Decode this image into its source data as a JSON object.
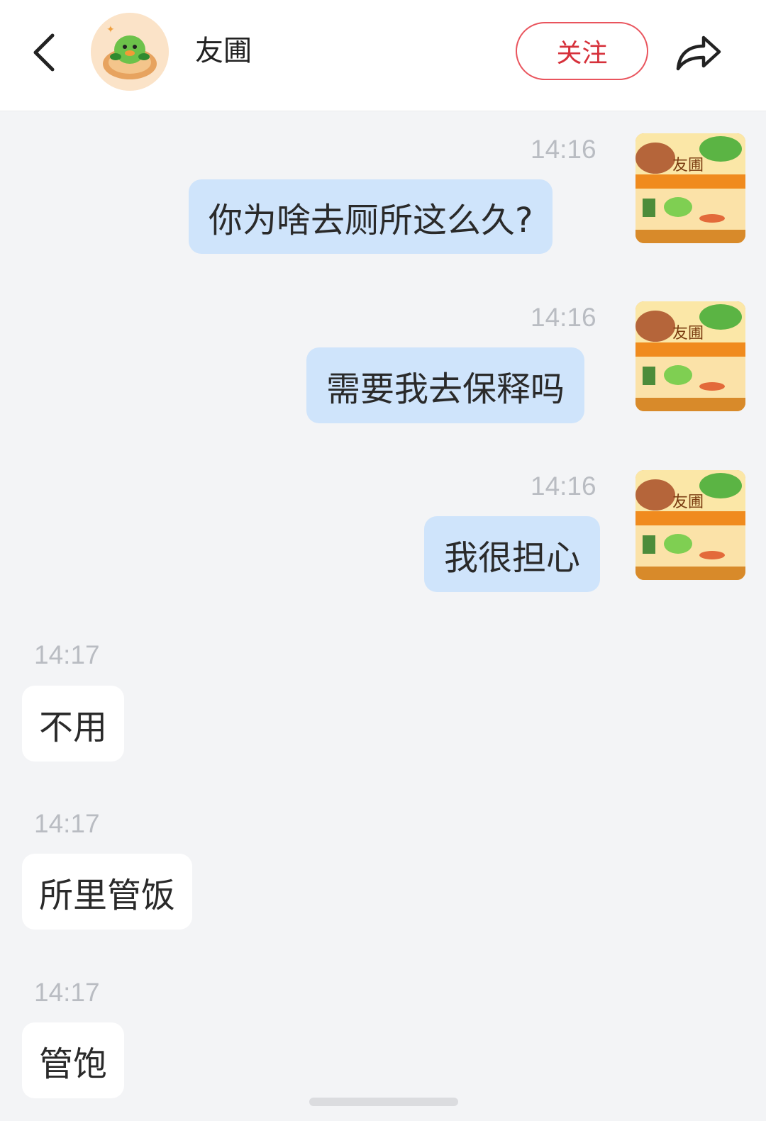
{
  "header": {
    "contact_name": "友圃",
    "follow_label": "关注",
    "back_icon": "chevron-left-icon",
    "share_icon": "share-arrow-icon"
  },
  "self_avatar_text": "友圃",
  "messages": [
    {
      "time": "14:16",
      "text": "你为啥去厕所这么久?",
      "from": "self"
    },
    {
      "time": "14:16",
      "text": "需要我去保释吗",
      "from": "self"
    },
    {
      "time": "14:16",
      "text": "我很担心",
      "from": "self"
    },
    {
      "time": "14:17",
      "text": "不用",
      "from": "other"
    },
    {
      "time": "14:17",
      "text": "所里管饭",
      "from": "other"
    },
    {
      "time": "14:17",
      "text": "管饱",
      "from": "other"
    }
  ],
  "colors": {
    "sent_bubble": "#cfe4fb",
    "received_bubble": "#ffffff",
    "follow_accent": "#e9545d",
    "background": "#f3f4f6"
  }
}
